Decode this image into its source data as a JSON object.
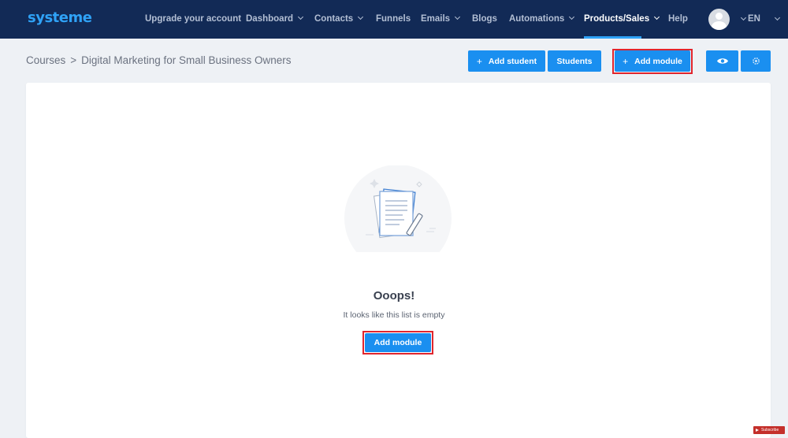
{
  "app": {
    "logo_text": "systeme"
  },
  "nav": {
    "items": [
      {
        "label": "Upgrade your account",
        "has_dropdown": false
      },
      {
        "label": "Dashboard",
        "has_dropdown": true
      },
      {
        "label": "Contacts",
        "has_dropdown": true
      },
      {
        "label": "Funnels",
        "has_dropdown": false
      },
      {
        "label": "Emails",
        "has_dropdown": true
      },
      {
        "label": "Blogs",
        "has_dropdown": false
      },
      {
        "label": "Automations",
        "has_dropdown": true
      },
      {
        "label": "Products/Sales",
        "has_dropdown": true,
        "active": true
      },
      {
        "label": "Help",
        "has_dropdown": false
      }
    ],
    "language": "EN",
    "avatar_icon": "user-avatar-icon"
  },
  "breadcrumb": {
    "items": [
      "Courses",
      "Digital Marketing for Small Business Owners"
    ],
    "separator": ">"
  },
  "toolbar": {
    "add_student_label": "Add student",
    "students_label": "Students",
    "add_module_label": "Add module",
    "preview_icon": "eye-icon",
    "settings_icon": "gear-icon"
  },
  "empty_state": {
    "illustration": "document-pen-illustration",
    "title": "Ooops!",
    "message": "It looks like this list is empty",
    "button_label": "Add module"
  },
  "watermark": {
    "label": "Subscribe"
  },
  "colors": {
    "nav_bg": "#122a56",
    "accent": "#1a8ff0",
    "logo": "#2fa2f6",
    "highlight": "#e0252d",
    "page_bg": "#eef1f5"
  }
}
